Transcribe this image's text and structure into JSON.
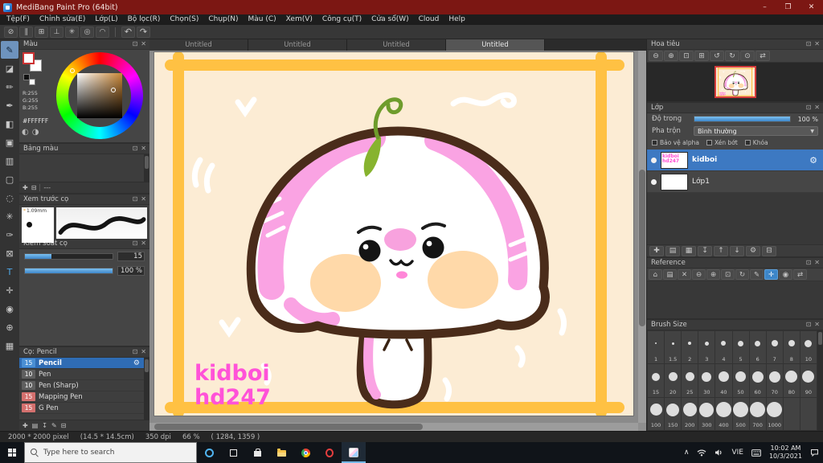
{
  "window": {
    "title": "MediBang Paint Pro (64bit)",
    "controls": {
      "minimize": "–",
      "maximize": "❐",
      "close": "✕"
    }
  },
  "menu": {
    "items": [
      "Tệp(F)",
      "Chỉnh sửa(E)",
      "Lớp(L)",
      "Bộ lọc(R)",
      "Chọn(S)",
      "Chụp(N)",
      "Màu (C)",
      "Xem(V)",
      "Công cụ(T)",
      "Cửa sổ(W)",
      "Cloud",
      "Help"
    ]
  },
  "toolbar": {
    "snap_tools": [
      {
        "name": "snap-off-icon",
        "glyph": "⊘"
      },
      {
        "name": "parallel-snap-icon",
        "glyph": "∥"
      },
      {
        "name": "cross-snap-icon",
        "glyph": "⊞"
      },
      {
        "name": "vanishing-point-snap-icon",
        "glyph": "⊥"
      },
      {
        "name": "radial-snap-icon",
        "glyph": "✳"
      },
      {
        "name": "ellipse-snap-icon",
        "glyph": "◎"
      },
      {
        "name": "curve-snap-icon",
        "glyph": "◠"
      }
    ],
    "undo": {
      "name": "undo-icon",
      "glyph": "↶"
    },
    "redo": {
      "name": "redo-icon",
      "glyph": "↷"
    }
  },
  "panel_header_icons": [
    {
      "name": "panel-popout-icon",
      "glyph": "⊡"
    },
    {
      "name": "panel-close-icon",
      "glyph": "✕"
    }
  ],
  "tool_strip": [
    {
      "name": "brush-tool",
      "glyph": "✎",
      "active": true
    },
    {
      "name": "eraser-tool",
      "glyph": "◪"
    },
    {
      "name": "pen-tool",
      "glyph": "✏"
    },
    {
      "name": "airbrush-tool",
      "glyph": "✒"
    },
    {
      "name": "fill-tool",
      "glyph": "◧"
    },
    {
      "name": "bucket-tool",
      "glyph": "▣"
    },
    {
      "name": "gradient-tool",
      "glyph": "▥"
    },
    {
      "name": "select-tool",
      "glyph": "▢"
    },
    {
      "name": "lasso-tool",
      "glyph": "◌"
    },
    {
      "name": "magic-wand-tool",
      "glyph": "✳"
    },
    {
      "name": "select-pen-tool",
      "glyph": "✑"
    },
    {
      "name": "select-eraser-tool",
      "glyph": "⊠"
    },
    {
      "name": "text-tool",
      "glyph": "T",
      "color": "#4fa8e8"
    },
    {
      "name": "pan-tool",
      "glyph": "✛"
    },
    {
      "name": "eyedropper-tool",
      "glyph": "◉"
    },
    {
      "name": "zoom-tool",
      "glyph": "⊕"
    },
    {
      "name": "divide-tool",
      "glyph": "▦"
    }
  ],
  "tabs": [
    {
      "label": "Untitled"
    },
    {
      "label": "Untitled"
    },
    {
      "label": "Untitled"
    },
    {
      "label": "Untitled",
      "active": true
    }
  ],
  "panels": {
    "color": {
      "title": "Màu",
      "rgb": [
        "R:255",
        "G:255",
        "B:255"
      ],
      "hex": "#FFFFFF"
    },
    "palette": {
      "title": "Bảng màu",
      "value": "---",
      "tool_icons": [
        {
          "name": "add-swatch-icon",
          "glyph": "✚"
        },
        {
          "name": "delete-swatch-icon",
          "glyph": "⊟"
        }
      ]
    },
    "brush_preview": {
      "title": "Xem trước cọ",
      "size": "1.09mm"
    },
    "brush_control": {
      "title": "Kiểm soát cọ",
      "sliders": [
        {
          "name": "brush-size-slider",
          "value": "15",
          "fill": 30
        },
        {
          "name": "brush-opacity-slider",
          "value": "100 %",
          "fill": 100
        }
      ]
    },
    "brush_list": {
      "title": "Cọ: Pencil",
      "brushes": [
        {
          "size": "15",
          "name": "Pencil",
          "selected": true,
          "tag": "#4a8fd4"
        },
        {
          "size": "10",
          "name": "Pen",
          "tag": "#5f5f5f"
        },
        {
          "size": "10",
          "name": "Pen (Sharp)",
          "tag": "#5f5f5f"
        },
        {
          "size": "15",
          "name": "Mapping Pen",
          "tag": "#d4706e"
        },
        {
          "size": "15",
          "name": "G Pen",
          "tag": "#d4706e"
        }
      ],
      "tool_icons": [
        {
          "name": "new-brush-icon",
          "glyph": "✚"
        },
        {
          "name": "brush-folder-icon",
          "glyph": "▤"
        },
        {
          "name": "save-brush-icon",
          "glyph": "↧"
        },
        {
          "name": "edit-brush-icon",
          "glyph": "✎"
        },
        {
          "name": "delete-brush-icon",
          "glyph": "⊟"
        }
      ]
    },
    "navigator": {
      "title": "Hoa tiêu",
      "zoom_icons": [
        {
          "name": "zoom-out-icon",
          "glyph": "⊖"
        },
        {
          "name": "zoom-in-icon",
          "glyph": "⊕"
        },
        {
          "name": "fit-window-icon",
          "glyph": "⊡"
        },
        {
          "name": "actual-size-icon",
          "glyph": "⊞"
        },
        {
          "name": "rotate-left-icon",
          "glyph": "↺"
        },
        {
          "name": "rotate-right-icon",
          "glyph": "↻"
        },
        {
          "name": "reset-view-icon",
          "glyph": "⊙"
        },
        {
          "name": "flip-view-icon",
          "glyph": "⇄"
        }
      ]
    },
    "layers": {
      "title": "Lớp",
      "opacity_label": "Độ trong",
      "opacity_value": "100 %",
      "opacity_fill": 100,
      "blend_label": "Pha trộn",
      "blend_value": "Bình thường",
      "checkboxes": [
        "Bảo vệ alpha",
        "Xén bớt",
        "Khóa"
      ],
      "items": [
        {
          "name": "kidboi",
          "selected": true,
          "thumb": "signature"
        },
        {
          "name": "Lớp1",
          "selected": false,
          "thumb": "blank"
        }
      ],
      "tool_icons": [
        {
          "name": "new-layer-icon",
          "glyph": "✚"
        },
        {
          "name": "new-folder-icon",
          "glyph": "▤"
        },
        {
          "name": "duplicate-layer-icon",
          "glyph": "▦"
        },
        {
          "name": "merge-layer-icon",
          "glyph": "↧"
        },
        {
          "name": "move-layer-up-icon",
          "glyph": "↑"
        },
        {
          "name": "move-layer-down-icon",
          "glyph": "↓"
        },
        {
          "name": "layer-settings-icon",
          "glyph": "⚙"
        },
        {
          "name": "delete-layer-icon",
          "glyph": "⊟"
        }
      ]
    },
    "reference": {
      "title": "Reference",
      "tool_icons": [
        {
          "name": "home-icon",
          "glyph": "⌂"
        },
        {
          "name": "open-image-icon",
          "glyph": "▤"
        },
        {
          "name": "clear-icon",
          "glyph": "✕"
        },
        {
          "name": "ref-zoom-out-icon",
          "glyph": "⊖"
        },
        {
          "name": "ref-zoom-in-icon",
          "glyph": "⊕"
        },
        {
          "name": "ref-fit-icon",
          "glyph": "⊡"
        },
        {
          "name": "ref-rotate-icon",
          "glyph": "↻"
        },
        {
          "name": "ref-pencil-icon",
          "glyph": "✎"
        },
        {
          "name": "ref-pan-icon",
          "glyph": "✛",
          "active": true
        },
        {
          "name": "ref-eyedropper-icon",
          "glyph": "◉"
        },
        {
          "name": "ref-flip-icon",
          "glyph": "⇄"
        }
      ]
    },
    "brush_size": {
      "title": "Brush Size",
      "sizes": [
        1,
        1.5,
        2,
        3,
        4,
        5,
        6,
        7,
        8,
        10,
        15,
        20,
        25,
        30,
        40,
        50,
        60,
        70,
        80,
        90,
        100,
        150,
        200,
        300,
        400,
        500,
        700,
        1000
      ]
    }
  },
  "canvas": {
    "signature_line1": "kidboi",
    "signature_line2": "hd247",
    "colors": {
      "background": "#fcecd4",
      "frame": "#ffc143",
      "outline": "#4a2c1a",
      "body": "#ffffff",
      "pink": "#faa3e3",
      "cheek": "#ffd9a9",
      "sprout_leaf": "#87b32f",
      "signature": "#ff52d8"
    }
  },
  "status": {
    "canvas_size": "2000 * 2000 pixel",
    "print_size": "(14.5 * 14.5cm)",
    "dpi": "350 dpi",
    "zoom": "66 %",
    "cursor": "( 1284, 1359 )"
  },
  "taskbar": {
    "search_placeholder": "Type here to search",
    "language": "VIE",
    "time": "10:02 AM",
    "date": "10/3/2021"
  }
}
